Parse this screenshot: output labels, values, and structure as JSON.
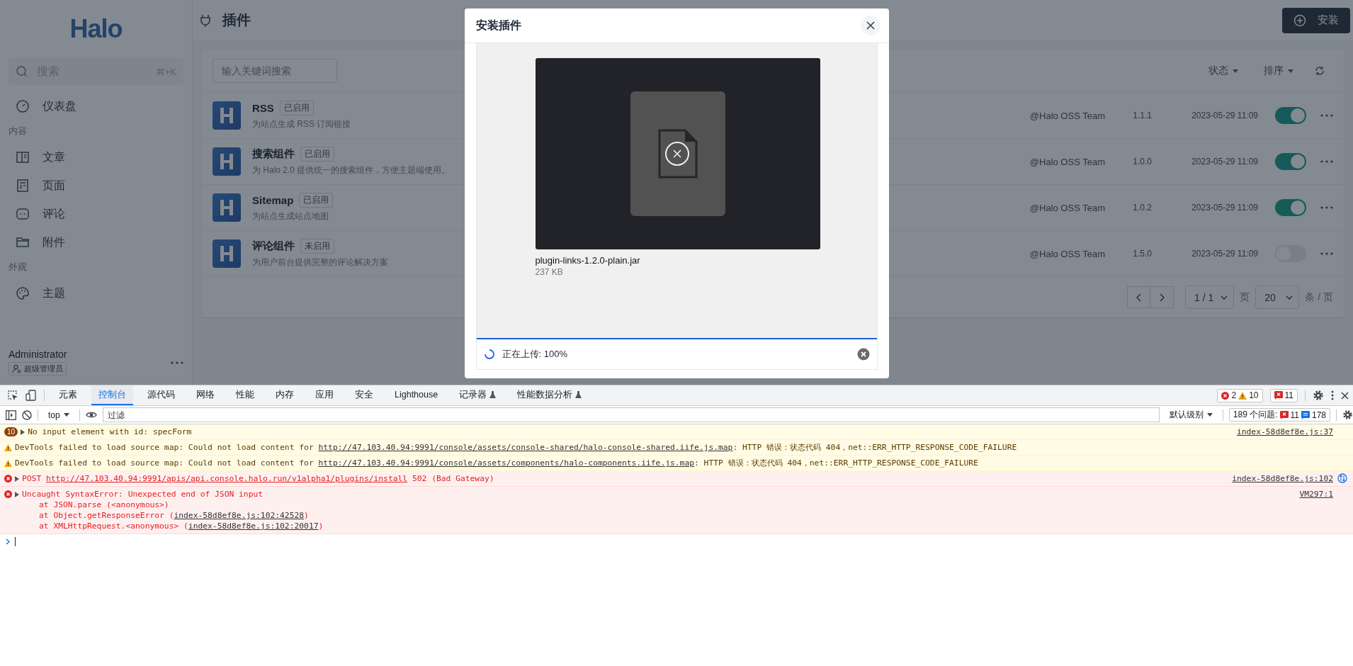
{
  "sidebar": {
    "logo": "Halo",
    "search": {
      "placeholder": "搜索",
      "shortcut": "⌘+K"
    },
    "nav": [
      {
        "kind": "item",
        "label": "仪表盘",
        "selected": false
      },
      {
        "kind": "group",
        "label": "内容"
      },
      {
        "kind": "item",
        "label": "文章",
        "selected": false
      },
      {
        "kind": "item",
        "label": "页面",
        "selected": false
      },
      {
        "kind": "item",
        "label": "评论",
        "selected": false
      },
      {
        "kind": "item",
        "label": "附件",
        "selected": false
      },
      {
        "kind": "group",
        "label": "外观"
      },
      {
        "kind": "item",
        "label": "主题",
        "selected": false
      }
    ],
    "user": {
      "name": "Administrator",
      "role": "超级管理员"
    }
  },
  "header": {
    "title": "插件",
    "install_button": "安装"
  },
  "toolbar": {
    "search_placeholder": "输入关键词搜索",
    "filters": [
      "状态",
      "排序"
    ]
  },
  "plugins": [
    {
      "name": "RSS",
      "status": "已启用",
      "description": "为站点生成 RSS 订阅链接",
      "author": "@Halo OSS Team",
      "version": "1.1.1",
      "time": "2023-05-29 11:09",
      "enabled": true
    },
    {
      "name": "搜索组件",
      "status": "已启用",
      "description": "为 Halo 2.0 提供统一的搜索组件，方便主题端使用。",
      "author": "@Halo OSS Team",
      "version": "1.0.0",
      "time": "2023-05-29 11:09",
      "enabled": true
    },
    {
      "name": "Sitemap",
      "status": "已启用",
      "description": "为站点生成站点地图",
      "author": "@Halo OSS Team",
      "version": "1.0.2",
      "time": "2023-05-29 11:09",
      "enabled": true
    },
    {
      "name": "评论组件",
      "status": "未启用",
      "description": "为用户前台提供完整的评论解决方案",
      "author": "@Halo OSS Team",
      "version": "1.5.0",
      "time": "2023-05-29 11:09",
      "enabled": false
    }
  ],
  "pagination": {
    "page": "1 / 1",
    "page_label": "页",
    "size": "20",
    "size_label": "条 / 页"
  },
  "modal": {
    "title": "安装插件",
    "file": {
      "name": "plugin-links-1.2.0-plain.jar",
      "size": "237 KB"
    },
    "upload": {
      "status": "正在上传: 100%",
      "level": 1
    }
  },
  "devtools": {
    "tabs": [
      {
        "label": "元素",
        "selected": false,
        "flask": false
      },
      {
        "label": "控制台",
        "selected": true,
        "flask": false
      },
      {
        "label": "源代码",
        "selected": false,
        "flask": false
      },
      {
        "label": "网络",
        "selected": false,
        "flask": false
      },
      {
        "label": "性能",
        "selected": false,
        "flask": false
      },
      {
        "label": "内存",
        "selected": false,
        "flask": false
      },
      {
        "label": "应用",
        "selected": false,
        "flask": false
      },
      {
        "label": "安全",
        "selected": false,
        "flask": false
      },
      {
        "label": "Lighthouse",
        "selected": false,
        "flask": false
      },
      {
        "label": "记录器",
        "selected": false,
        "flask": true
      },
      {
        "label": "性能数据分析",
        "selected": false,
        "flask": true
      }
    ],
    "counts": {
      "errors": "2",
      "warnings": "10",
      "issues": "11"
    },
    "console_toolbar": {
      "context": "top",
      "filter_placeholder": "过滤",
      "level": "默认级别",
      "issues_label": "189 个问题:",
      "issue_errors": "11",
      "issue_info": "178"
    },
    "messages": [
      {
        "kind": "warning",
        "count": "10",
        "expandable": true,
        "network": false,
        "source": "index-58d8ef8e.js:37",
        "lines": [
          [
            {
              "text": "No input element with id: specForm"
            }
          ]
        ]
      },
      {
        "kind": "warning",
        "expandable": false,
        "network": false,
        "lines": [
          [
            {
              "text": "DevTools failed to load source map: Could not load content for "
            },
            {
              "link": "http://47.103.40.94:9991/console/assets/console-shared/halo-console-shared.iife.js.map"
            },
            {
              "text": ": HTTP 错误：状态代码 404，net::ERR_HTTP_RESPONSE_CODE_FAILURE"
            }
          ]
        ]
      },
      {
        "kind": "warning",
        "expandable": false,
        "network": false,
        "lines": [
          [
            {
              "text": "DevTools failed to load source map: Could not load content for "
            },
            {
              "link": "http://47.103.40.94:9991/console/assets/components/halo-components.iife.js.map"
            },
            {
              "text": ": HTTP 错误：状态代码 404，net::ERR_HTTP_RESPONSE_CODE_FAILURE"
            }
          ]
        ]
      },
      {
        "kind": "error",
        "expandable": true,
        "network": true,
        "source": "index-58d8ef8e.js:102",
        "lines": [
          [
            {
              "text": "POST "
            },
            {
              "link": "http://47.103.40.94:9991/apis/api.console.halo.run/v1alpha1/plugins/install"
            },
            {
              "text": " 502 (Bad Gateway)"
            }
          ]
        ]
      },
      {
        "kind": "error",
        "expandable": true,
        "network": false,
        "source": "VM297:1",
        "lines": [
          [
            {
              "text": "Uncaught SyntaxError: Unexpected end of JSON input"
            }
          ],
          [
            {
              "text": "at JSON.parse (<anonymous>)"
            }
          ],
          [
            {
              "text": "at Object.getResponseError ("
            },
            {
              "link": "index-58d8ef8e.js:102:42528"
            },
            {
              "text": ")"
            }
          ],
          [
            {
              "text": "at XMLHttpRequest.<anonymous> ("
            },
            {
              "link": "index-58d8ef8e.js:102:20017"
            },
            {
              "text": ")"
            }
          ]
        ]
      }
    ]
  }
}
